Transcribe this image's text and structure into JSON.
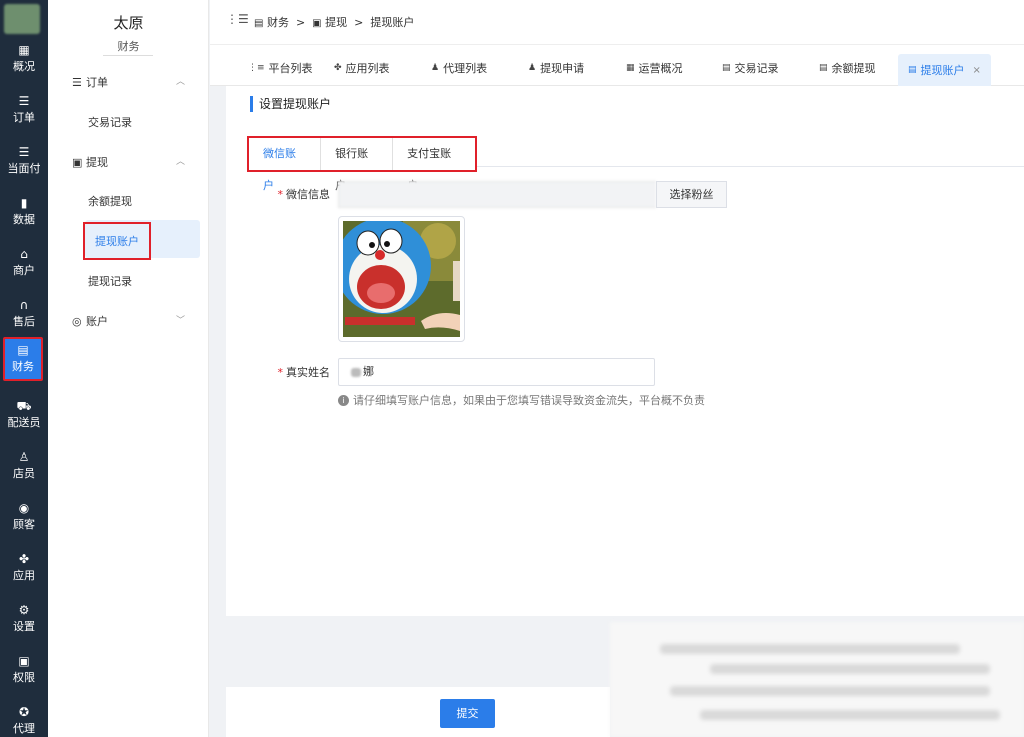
{
  "rail": {
    "items": [
      {
        "label": "概况",
        "icon": "overview-icon",
        "glyph": "▦"
      },
      {
        "label": "订单",
        "icon": "list-icon",
        "glyph": "☰"
      },
      {
        "label": "当面付",
        "icon": "list-icon",
        "glyph": "☰"
      },
      {
        "label": "数据",
        "icon": "bar-chart-icon",
        "glyph": "▮"
      },
      {
        "label": "商户",
        "icon": "store-icon",
        "glyph": "⌂"
      },
      {
        "label": "售后",
        "icon": "headset-icon",
        "glyph": "∩"
      },
      {
        "label": "财务",
        "icon": "finance-icon",
        "glyph": "▤"
      },
      {
        "label": "配送员",
        "icon": "truck-icon",
        "glyph": "⛟"
      },
      {
        "label": "店员",
        "icon": "user-icon",
        "glyph": "♙"
      },
      {
        "label": "顾客",
        "icon": "customer-icon",
        "glyph": "◉"
      },
      {
        "label": "应用",
        "icon": "apps-icon",
        "glyph": "✤"
      },
      {
        "label": "设置",
        "icon": "settings-icon",
        "glyph": "⚙"
      },
      {
        "label": "权限",
        "icon": "lock-icon",
        "glyph": "▣"
      },
      {
        "label": "代理",
        "icon": "agent-icon",
        "glyph": "✪"
      }
    ],
    "active_index": 6,
    "accent": "#2b7de9",
    "highlight": "#e0202a"
  },
  "sidebar": {
    "title": "太原",
    "subtitle": "财务",
    "groups": {
      "order": {
        "label": "订单",
        "icon": "list-icon"
      },
      "withdraw": {
        "label": "提现",
        "icon": "withdraw-icon"
      },
      "account": {
        "label": "账户",
        "icon": "account-icon"
      }
    },
    "items": {
      "trade_record": "交易记录",
      "balance_withdraw": "余额提现",
      "withdraw_account": "提现账户",
      "withdraw_record": "提现记录"
    }
  },
  "breadcrumb": [
    "财务",
    "提现",
    "提现账户"
  ],
  "breadcrumb_sep": ">",
  "tabs": [
    {
      "label": "平台列表",
      "icon": "platform-icon"
    },
    {
      "label": "应用列表",
      "icon": "apps-icon"
    },
    {
      "label": "代理列表",
      "icon": "agent-icon"
    },
    {
      "label": "提现申请",
      "icon": "user-icon"
    },
    {
      "label": "运营概况",
      "icon": "grid-icon"
    },
    {
      "label": "交易记录",
      "icon": "document-icon"
    },
    {
      "label": "余额提现",
      "icon": "document-icon"
    },
    {
      "label": "提现账户",
      "icon": "document-icon",
      "active": true
    }
  ],
  "tab_close": "×",
  "main": {
    "section_title": "设置提现账户",
    "account_tabs": [
      "微信账户",
      "银行账户",
      "支付宝账户"
    ],
    "wechat_label": "微信信息",
    "wechat_value": "",
    "select_fan_button": "选择粉丝",
    "real_name_label": "真实姓名",
    "real_name_value": "娜",
    "required_mark": "*",
    "tip": "请仔细填写账户信息，如果由于您填写错误导致资金流失，平台概不负责"
  },
  "submit_label": "提交"
}
